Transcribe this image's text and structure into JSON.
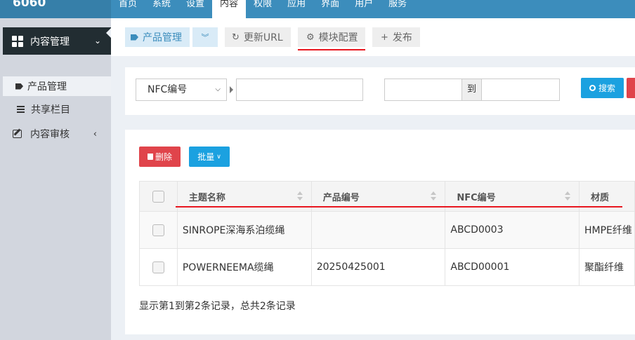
{
  "topbar": {
    "logo": "6060",
    "nav": [
      "首页",
      "系统",
      "设置",
      "内容",
      "权限",
      "应用",
      "界面",
      "用户",
      "服务"
    ],
    "active_index": 3
  },
  "sidebar": {
    "main_label": "内容管理",
    "sub_items": [
      "产品管理",
      "共享栏目"
    ],
    "review_label": "内容审核"
  },
  "tabs": {
    "product": "产品管理",
    "refresh": "更新URL",
    "module": "模块配置",
    "publish": "发布"
  },
  "search": {
    "field_select": "NFC编号",
    "to_label": "到",
    "search_button": "搜索"
  },
  "actions": {
    "delete": "删除",
    "batch": "批量"
  },
  "table": {
    "columns": [
      "主题名称",
      "产品编号",
      "NFC编号",
      "材质"
    ],
    "rows": [
      {
        "title": "SINROPE深海系泊缆绳",
        "product_no": "",
        "nfc": "ABCD0003",
        "material": "HMPE纤维"
      },
      {
        "title": "POWERNEEMA缆绳",
        "product_no": "20250425001",
        "nfc": "ABCD00001",
        "material": "聚酯纤维"
      }
    ],
    "summary": "显示第1到第2条记录，总共2条记录"
  },
  "colors": {
    "topbar": "#3c8dbc",
    "sidebar_active": "#222d32",
    "accent_red": "#e8161f",
    "search_button": "#1ba1e0",
    "delete_button": "#e0444b"
  }
}
